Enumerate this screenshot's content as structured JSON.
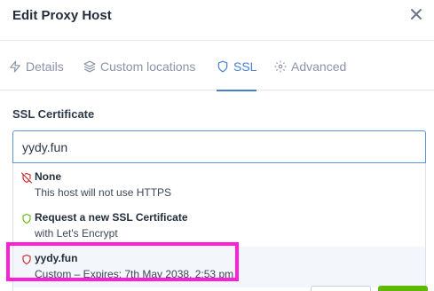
{
  "modal": {
    "title": "Edit Proxy Host"
  },
  "tabs": [
    {
      "label": "Details",
      "icon": "zap-icon",
      "active": false
    },
    {
      "label": "Custom locations",
      "icon": "layers-icon",
      "active": false
    },
    {
      "label": "SSL",
      "icon": "shield-icon",
      "active": true
    },
    {
      "label": "Advanced",
      "icon": "settings-icon",
      "active": false
    }
  ],
  "ssl": {
    "label": "SSL Certificate",
    "input_value": "yydy.fun",
    "options": [
      {
        "title": "None",
        "subtitle": "This host will not use HTTPS",
        "icon": "shield-off-icon",
        "icon_color": "#cd201f"
      },
      {
        "title": "Request a new SSL Certificate",
        "subtitle": "with Let's Encrypt",
        "icon": "shield-icon",
        "icon_color": "#5eba00"
      },
      {
        "title": "yydy.fun",
        "subtitle": "Custom – Expires: 7th May 2038, 2:53 pm",
        "icon": "shield-icon",
        "icon_color": "#cd201f",
        "highlighted": true
      }
    ]
  },
  "colors": {
    "accent": "#467fcf",
    "annotation_highlight": "#ff1fd8",
    "success": "#5eba00",
    "danger": "#cd201f"
  }
}
